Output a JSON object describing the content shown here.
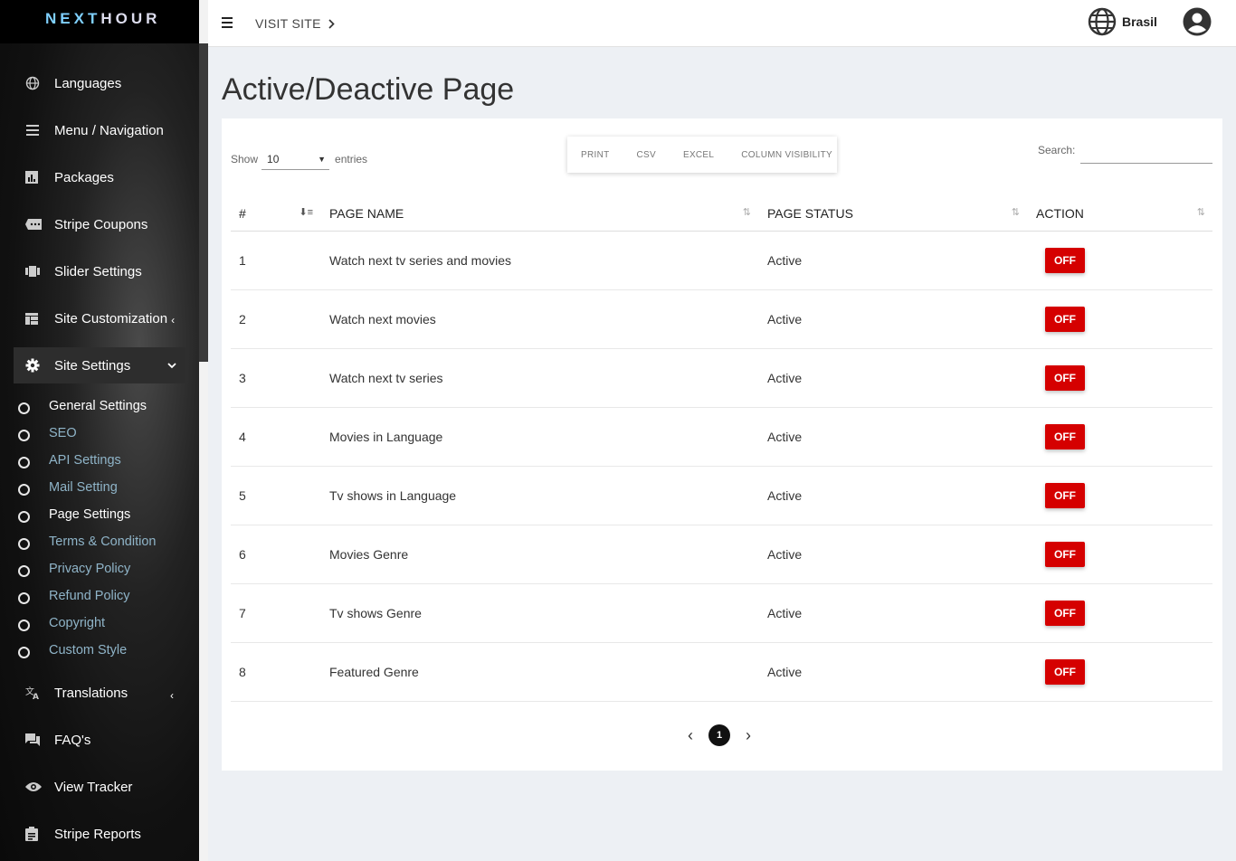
{
  "brand": {
    "pre": "NEXT",
    "post": "HOUR"
  },
  "sidebar": {
    "items": [
      {
        "label": "Languages",
        "icon": "globe-icon"
      },
      {
        "label": "Menu / Navigation",
        "icon": "menu-icon"
      },
      {
        "label": "Packages",
        "icon": "chart-icon"
      },
      {
        "label": "Stripe Coupons",
        "icon": "ticket-icon"
      },
      {
        "label": "Slider Settings",
        "icon": "slider-icon"
      },
      {
        "label": "Site Customization",
        "icon": "dashboard-icon",
        "chev": "‹"
      },
      {
        "label": "Site Settings",
        "icon": "gear-icon",
        "chev": "⌄"
      },
      {
        "label": "Translations",
        "icon": "translate-icon",
        "chev": "‹"
      },
      {
        "label": "FAQ's",
        "icon": "chat-icon"
      },
      {
        "label": "View Tracker",
        "icon": "eye-icon"
      },
      {
        "label": "Stripe Reports",
        "icon": "clipboard-icon"
      }
    ],
    "sub_items": [
      "General Settings",
      "SEO",
      "API Settings",
      "Mail Setting",
      "Page Settings",
      "Terms & Condition",
      "Privacy Policy",
      "Refund Policy",
      "Copyright",
      "Custom Style"
    ]
  },
  "header": {
    "visit_label": "VISIT SITE",
    "language": "Brasil"
  },
  "page": {
    "title": "Active/Deactive Page"
  },
  "controls": {
    "show_label": "Show",
    "entries_value": "10",
    "entries_label": "entries",
    "buttons": [
      "PRINT",
      "CSV",
      "EXCEL",
      "COLUMN VISIBILITY"
    ],
    "search_label": "Search:",
    "search_value": ""
  },
  "table": {
    "headers": [
      "#",
      "PAGE NAME",
      "PAGE STATUS",
      "ACTION"
    ],
    "rows": [
      {
        "num": "1",
        "name": "Watch next tv series and movies",
        "status": "Active",
        "action": "OFF"
      },
      {
        "num": "2",
        "name": "Watch next movies",
        "status": "Active",
        "action": "OFF"
      },
      {
        "num": "3",
        "name": "Watch next tv series",
        "status": "Active",
        "action": "OFF"
      },
      {
        "num": "4",
        "name": "Movies in Language",
        "status": "Active",
        "action": "OFF"
      },
      {
        "num": "5",
        "name": "Tv shows in Language",
        "status": "Active",
        "action": "OFF"
      },
      {
        "num": "6",
        "name": "Movies Genre",
        "status": "Active",
        "action": "OFF"
      },
      {
        "num": "7",
        "name": "Tv shows Genre",
        "status": "Active",
        "action": "OFF"
      },
      {
        "num": "8",
        "name": "Featured Genre",
        "status": "Active",
        "action": "OFF"
      }
    ]
  },
  "pagination": {
    "current": "1",
    "prev": "‹",
    "next": "›"
  },
  "colors": {
    "off_button": "#d50000",
    "sidebar_bg": "#111111",
    "page_bg": "#edf0f4"
  }
}
